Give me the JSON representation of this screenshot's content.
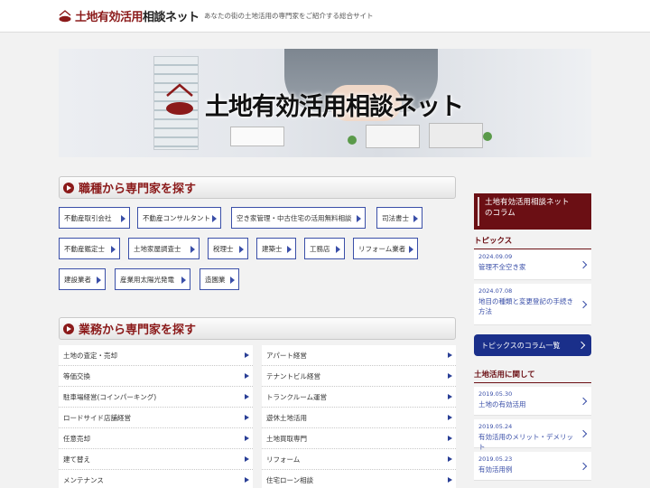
{
  "header": {
    "logo_prefix": "土地有効活用",
    "logo_suffix": "相談ネット",
    "tagline": "あなたの街の土地活用の専門家をご紹介する総合サイト"
  },
  "hero": {
    "title": "土地有効活用相談ネット"
  },
  "section_occupation": {
    "title": "職種から専門家を探す",
    "tags": [
      "不動産取引会社",
      "不動産コンサルタント",
      "空き家管理・中古住宅の活用無料相談",
      "司法書士",
      "不動産鑑定士",
      "土地家屋調査士",
      "税理士",
      "建築士",
      "工務店",
      "リフォーム業者",
      "建設業者",
      "産業用太陽光発電",
      "造園業"
    ]
  },
  "section_business": {
    "title": "業務から専門家を探す",
    "left": [
      "土地の査定・売却",
      "等価交換",
      "駐車場経営(コインパーキング)",
      "ロードサイド店舗経営",
      "任意売却",
      "建て替え",
      "メンテナンス"
    ],
    "right": [
      "アパート経営",
      "テナントビル経営",
      "トランクルーム運営",
      "遊休土地活用",
      "土地買取専門",
      "リフォーム",
      "住宅ローン相談"
    ]
  },
  "sidebar": {
    "column_header": "土地有効活用相談ネット\nのコラム",
    "topics_title": "トピックス",
    "topics": [
      {
        "date": "2024.09.09",
        "title": "管理不全空き家"
      },
      {
        "date": "2024.07.08",
        "title": "地目の種類と変更登記の手続き方法"
      }
    ],
    "topics_button": "トピックスのコラム一覧",
    "land_title": "土地活用に関して",
    "land_items": [
      {
        "date": "2019.05.30",
        "title": "土地の有効活用"
      },
      {
        "date": "2019.05.24",
        "title": "有効活用のメリット・デメリット"
      },
      {
        "date": "2019.05.23",
        "title": "有効活用例"
      }
    ]
  },
  "colors": {
    "brand_red": "#8b1a1a",
    "link_blue": "#3a4fa8",
    "button_navy": "#1a2f8a"
  }
}
